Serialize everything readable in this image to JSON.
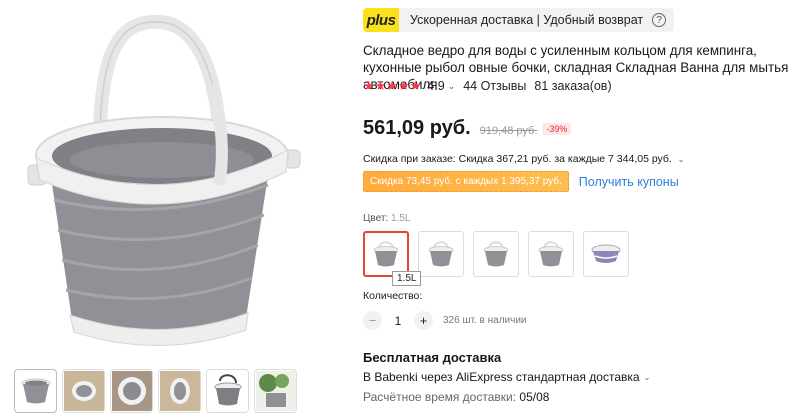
{
  "plus": {
    "logo": "plus",
    "text": "Ускоренная доставка | Удобный возврат",
    "help": "?"
  },
  "product": {
    "title": "Складное ведро для воды с усиленным кольцом для кемпинга, кухонные рыбол овные бочки, складная Складная Ванна для мытья автомобиля",
    "rating": "4.9",
    "reviews": "44 Отзывы",
    "orders": "81 заказа(ов)",
    "stars": "★★★★★"
  },
  "price": {
    "current": "561,09 руб.",
    "old": "919,48 руб.",
    "discount": "-39%"
  },
  "order_discount": "Скидка при заказе: Скидка 367,21 руб. за каждые 7 344,05 руб.",
  "coupon": {
    "badge": "Скидка 73,45 руб. с каждых 1 395,37 руб.",
    "link": "Получить купоны"
  },
  "color": {
    "label": "Цвет:",
    "value": "1.5L",
    "tooltip": "1.5L"
  },
  "quantity": {
    "label": "Количество:",
    "value": "1",
    "minus": "−",
    "plus": "+",
    "stock": "326 шт. в наличии"
  },
  "shipping": {
    "title": "Бесплатная доставка",
    "line": "В Babenki через AliExpress стандартная доставка",
    "delivery_label": "Расчётное время доставки:",
    "delivery_date": "05/08"
  },
  "colors": {
    "accent_red": "#fd384f",
    "plus_yellow": "#f9e21b",
    "link_blue": "#2d7edd",
    "coupon_orange": "#ffab3d"
  }
}
